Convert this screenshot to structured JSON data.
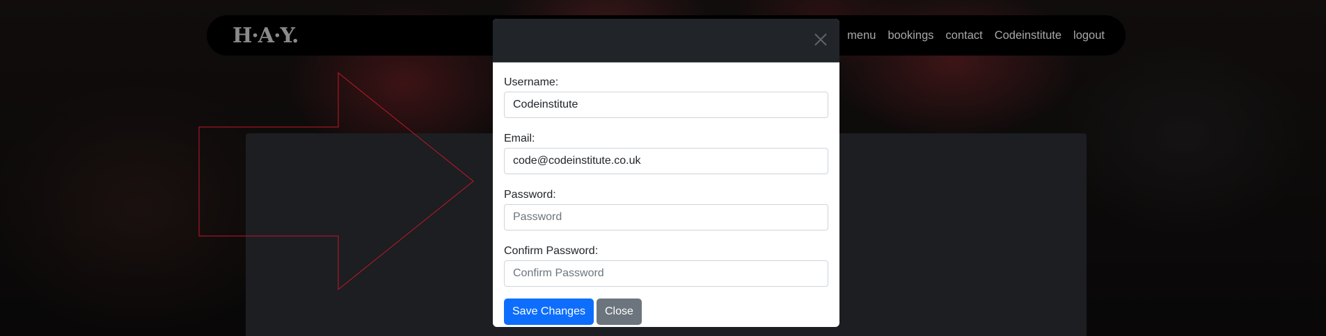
{
  "brand": {
    "logo_text": "H·A·Y."
  },
  "nav": {
    "links": [
      "menu",
      "bookings",
      "contact",
      "Codeinstitute",
      "logout"
    ]
  },
  "modal": {
    "username": {
      "label": "Username:",
      "value": "Codeinstitute"
    },
    "email": {
      "label": "Email:",
      "value": "code@codeinstitute.co.uk"
    },
    "password": {
      "label": "Password:",
      "placeholder": "Password"
    },
    "confirm_password": {
      "label": "Confirm Password:",
      "placeholder": "Confirm Password"
    },
    "save_label": "Save Changes",
    "close_label": "Close"
  },
  "colors": {
    "primary": "#0d6efd",
    "secondary": "#6c757d",
    "navbar": "#000000",
    "modal_header": "#212529",
    "arrow_outline": "#c0182a"
  },
  "icons": {
    "modal_close": "close-icon"
  }
}
